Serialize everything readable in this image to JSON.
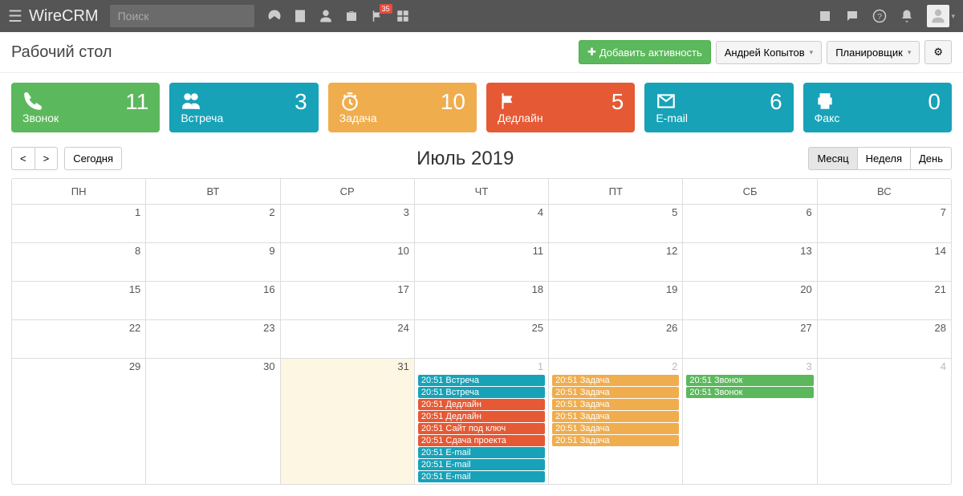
{
  "header": {
    "brand": "WireCRM",
    "search_placeholder": "Поиск",
    "flag_badge": "35"
  },
  "toolbar": {
    "page_title": "Рабочий стол",
    "add_activity": "Добавить активность",
    "user_name": "Андрей Копытов",
    "view_menu": "Планировщик"
  },
  "tiles": [
    {
      "label": "Звонок",
      "count": "11",
      "color": "t-green",
      "icon": "phone"
    },
    {
      "label": "Встреча",
      "count": "3",
      "color": "t-cyan",
      "icon": "users"
    },
    {
      "label": "Задача",
      "count": "10",
      "color": "t-orange",
      "icon": "clock"
    },
    {
      "label": "Дедлайн",
      "count": "5",
      "color": "t-red",
      "icon": "flag"
    },
    {
      "label": "E-mail",
      "count": "6",
      "color": "t-cyan",
      "icon": "mail"
    },
    {
      "label": "Факс",
      "count": "0",
      "color": "t-cyan",
      "icon": "print"
    }
  ],
  "calendar": {
    "prev": "<",
    "next": ">",
    "today": "Сегодня",
    "title": "Июль 2019",
    "view_month": "Месяц",
    "view_week": "Неделя",
    "view_day": "День",
    "dow": [
      "ПН",
      "ВТ",
      "СР",
      "ЧТ",
      "ПТ",
      "СБ",
      "ВС"
    ],
    "weeks": [
      [
        {
          "n": "1"
        },
        {
          "n": "2"
        },
        {
          "n": "3"
        },
        {
          "n": "4"
        },
        {
          "n": "5"
        },
        {
          "n": "6"
        },
        {
          "n": "7"
        }
      ],
      [
        {
          "n": "8"
        },
        {
          "n": "9"
        },
        {
          "n": "10"
        },
        {
          "n": "11"
        },
        {
          "n": "12"
        },
        {
          "n": "13"
        },
        {
          "n": "14"
        }
      ],
      [
        {
          "n": "15"
        },
        {
          "n": "16"
        },
        {
          "n": "17"
        },
        {
          "n": "18"
        },
        {
          "n": "19"
        },
        {
          "n": "20"
        },
        {
          "n": "21"
        }
      ],
      [
        {
          "n": "22"
        },
        {
          "n": "23"
        },
        {
          "n": "24"
        },
        {
          "n": "25"
        },
        {
          "n": "26"
        },
        {
          "n": "27"
        },
        {
          "n": "28"
        }
      ],
      [
        {
          "n": "29"
        },
        {
          "n": "30"
        },
        {
          "n": "31",
          "today": true
        },
        {
          "n": "1",
          "muted": true,
          "events": [
            {
              "t": "20:51 Встреча",
              "c": "ev-cyan"
            },
            {
              "t": "20:51 Встреча",
              "c": "ev-cyan"
            },
            {
              "t": "20:51 Дедлайн",
              "c": "ev-red"
            },
            {
              "t": "20:51 Дедлайн",
              "c": "ev-red"
            },
            {
              "t": "20:51 Сайт под ключ",
              "c": "ev-red"
            },
            {
              "t": "20:51 Сдача проекта",
              "c": "ev-red"
            },
            {
              "t": "20:51 E-mail",
              "c": "ev-cyan"
            },
            {
              "t": "20:51 E-mail",
              "c": "ev-cyan"
            },
            {
              "t": "20:51 E-mail",
              "c": "ev-cyan"
            }
          ]
        },
        {
          "n": "2",
          "muted": true,
          "events": [
            {
              "t": "20:51 Задача",
              "c": "ev-orange"
            },
            {
              "t": "20:51 Задача",
              "c": "ev-orange"
            },
            {
              "t": "20:51 Задача",
              "c": "ev-orange"
            },
            {
              "t": "20:51 Задача",
              "c": "ev-orange"
            },
            {
              "t": "20:51 Задача",
              "c": "ev-orange"
            },
            {
              "t": "20:51 Задача",
              "c": "ev-orange"
            }
          ]
        },
        {
          "n": "3",
          "muted": true,
          "events": [
            {
              "t": "20:51 Звонок",
              "c": "ev-green"
            },
            {
              "t": "20:51 Звонок",
              "c": "ev-green"
            }
          ]
        },
        {
          "n": "4",
          "muted": true
        }
      ]
    ]
  }
}
